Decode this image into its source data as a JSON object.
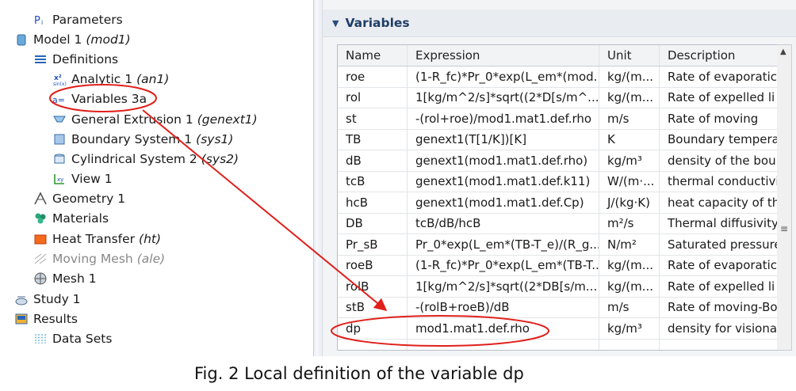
{
  "tree": {
    "items": [
      {
        "label": "Parameters",
        "tag": "",
        "icon": "parameters-icon",
        "indent": 1
      },
      {
        "label": "Model 1",
        "tag": "(mod1)",
        "icon": "model-icon",
        "indent": 0
      },
      {
        "label": "Definitions",
        "tag": "",
        "icon": "definitions-icon",
        "indent": 1
      },
      {
        "label": "Analytic 1",
        "tag": "(an1)",
        "icon": "analytic-function-icon",
        "indent": 2
      },
      {
        "label": "Variables 3a",
        "tag": "",
        "icon": "variables-icon",
        "indent": 2
      },
      {
        "label": "General Extrusion 1",
        "tag": "(genext1)",
        "icon": "extrusion-icon",
        "indent": 2
      },
      {
        "label": "Boundary System 1",
        "tag": "(sys1)",
        "icon": "boundary-system-icon",
        "indent": 2
      },
      {
        "label": "Cylindrical System 2",
        "tag": "(sys2)",
        "icon": "cylindrical-system-icon",
        "indent": 2
      },
      {
        "label": "View 1",
        "tag": "",
        "icon": "view-icon",
        "indent": 2
      },
      {
        "label": "Geometry 1",
        "tag": "",
        "icon": "geometry-icon",
        "indent": 1
      },
      {
        "label": "Materials",
        "tag": "",
        "icon": "materials-icon",
        "indent": 1
      },
      {
        "label": "Heat Transfer",
        "tag": "(ht)",
        "icon": "heat-transfer-icon",
        "indent": 1
      },
      {
        "label": "Moving Mesh",
        "tag": "(ale)",
        "icon": "moving-mesh-icon",
        "indent": 1,
        "disabled": true
      },
      {
        "label": "Mesh 1",
        "tag": "",
        "icon": "mesh-icon",
        "indent": 1
      },
      {
        "label": "Study 1",
        "tag": "",
        "icon": "study-icon",
        "indent": 0
      },
      {
        "label": "Results",
        "tag": "",
        "icon": "results-icon",
        "indent": 0
      },
      {
        "label": "Data Sets",
        "tag": "",
        "icon": "data-sets-icon",
        "indent": 1
      }
    ]
  },
  "panel": {
    "title": "Variables",
    "columns": [
      "Name",
      "Expression",
      "Unit",
      "Description"
    ],
    "rows": [
      [
        "roe",
        "(1-R_fc)*Pr_0*exp(L_em*(mod...",
        "kg/(m...",
        "Rate of evaporatic"
      ],
      [
        "rol",
        "1[kg/m^2/s]*sqrt((2*D[s/m^...",
        "kg/(m...",
        "Rate of expelled li"
      ],
      [
        "st",
        "-(rol+roe)/mod1.mat1.def.rho",
        "m/s",
        "Rate of moving"
      ],
      [
        "TB",
        "genext1(T[1/K])[K]",
        "K",
        "Boundary tempera"
      ],
      [
        "dB",
        "genext1(mod1.mat1.def.rho)",
        "kg/m³",
        "density of the bou"
      ],
      [
        "tcB",
        "genext1(mod1.mat1.def.k11)",
        "W/(m·...",
        "thermal conductivi"
      ],
      [
        "hcB",
        "genext1(mod1.mat1.def.Cp)",
        "J/(kg·K)",
        "heat capacity of th"
      ],
      [
        "DB",
        "tcB/dB/hcB",
        "m²/s",
        "Thermal diffusivity-"
      ],
      [
        "Pr_sB",
        "Pr_0*exp(L_em*(TB-T_e)/(R_g...",
        "N/m²",
        "Saturated pressure"
      ],
      [
        "roeB",
        "(1-R_fc)*Pr_0*exp(L_em*(TB-T...",
        "kg/(m...",
        "Rate of evaporatic"
      ],
      [
        "rolB",
        "1[kg/m^2/s]*sqrt((2*DB[s/m...",
        "kg/(m...",
        "Rate of expelled li"
      ],
      [
        "stB",
        "-(rolB+roeB)/dB",
        "m/s",
        "Rate of moving-Bo"
      ],
      [
        "dp",
        "mod1.mat1.def.rho",
        "kg/m³",
        "density for visiona"
      ]
    ]
  },
  "caption": "Fig. 2 Local definition of the variable dp",
  "colors": {
    "annotation": "#e0201b",
    "header_text": "#1f3d66"
  }
}
